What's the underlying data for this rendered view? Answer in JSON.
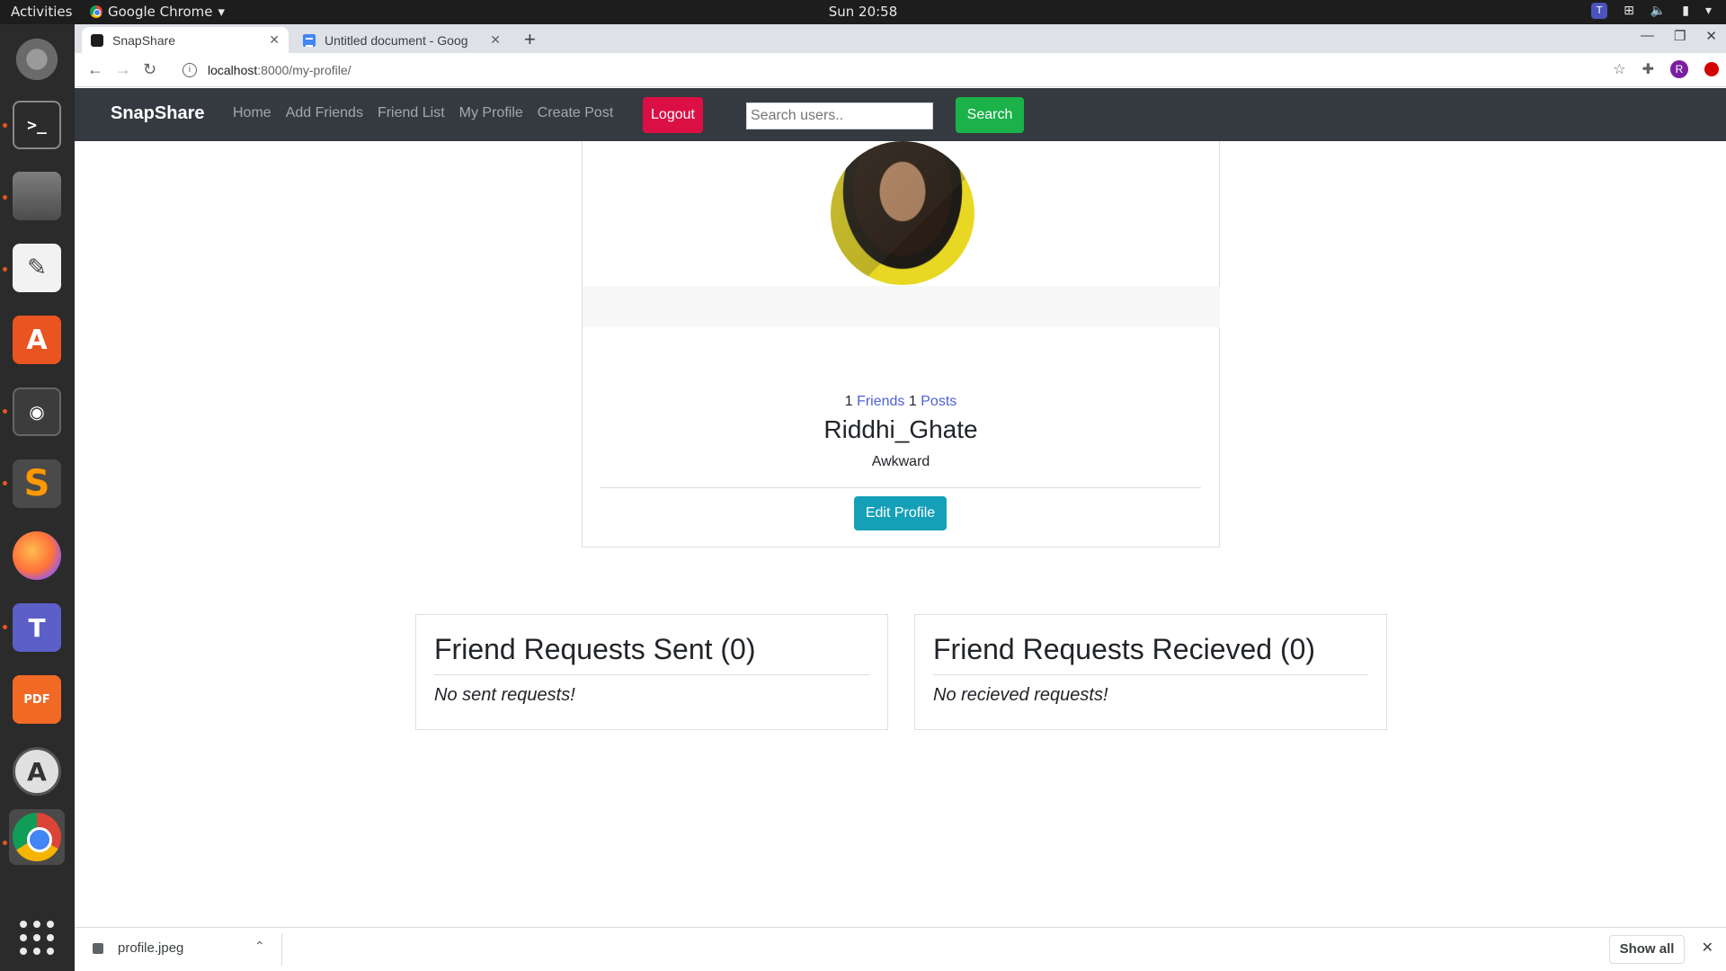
{
  "os_panel": {
    "activities": "Activities",
    "app_name": "Google Chrome",
    "clock": "Sun 20:58"
  },
  "dock": {
    "items": [
      {
        "name": "settings",
        "icon": "settings-icon"
      },
      {
        "name": "terminal",
        "icon": "terminal-icon",
        "glyph": ">_"
      },
      {
        "name": "files",
        "icon": "files-icon"
      },
      {
        "name": "text-editor",
        "icon": "text-editor-icon",
        "glyph": "✎"
      },
      {
        "name": "software",
        "icon": "software-center-icon",
        "glyph": "A"
      },
      {
        "name": "safe",
        "icon": "safe-icon",
        "glyph": "◉"
      },
      {
        "name": "sublime",
        "icon": "sublime-text-icon",
        "glyph": "S"
      },
      {
        "name": "firefox",
        "icon": "firefox-icon"
      },
      {
        "name": "teams",
        "icon": "teams-icon",
        "glyph": "T"
      },
      {
        "name": "pdf",
        "icon": "pdf-editor-icon",
        "glyph": "PDF"
      },
      {
        "name": "updater",
        "icon": "software-updater-icon",
        "glyph": "A"
      },
      {
        "name": "chrome",
        "icon": "chrome-icon"
      },
      {
        "name": "apps",
        "icon": "show-apps-icon"
      }
    ]
  },
  "browser": {
    "tabs": [
      {
        "title": "SnapShare",
        "active": true
      },
      {
        "title": "Untitled document - Goog",
        "active": false
      }
    ],
    "url_host": "localhost",
    "url_path": ":8000/my-profile/"
  },
  "navbar": {
    "brand": "SnapShare",
    "links": [
      "Home",
      "Add Friends",
      "Friend List",
      "My Profile",
      "Create Post"
    ],
    "logout_label": "Logout",
    "search_placeholder": "Search users..",
    "search_label": "Search"
  },
  "profile": {
    "friends_count": "1",
    "friends_label": "Friends",
    "posts_count": "1",
    "posts_label": "Posts",
    "username": "Riddhi_Ghate",
    "bio": "Awkward",
    "edit_label": "Edit Profile"
  },
  "requests": {
    "sent_title": "Friend Requests Sent (0)",
    "sent_empty": "No sent requests!",
    "received_title": "Friend Requests Recieved (0)",
    "received_empty": "No recieved requests!"
  },
  "downloads": {
    "file_name": "profile.jpeg",
    "show_all_label": "Show all"
  }
}
